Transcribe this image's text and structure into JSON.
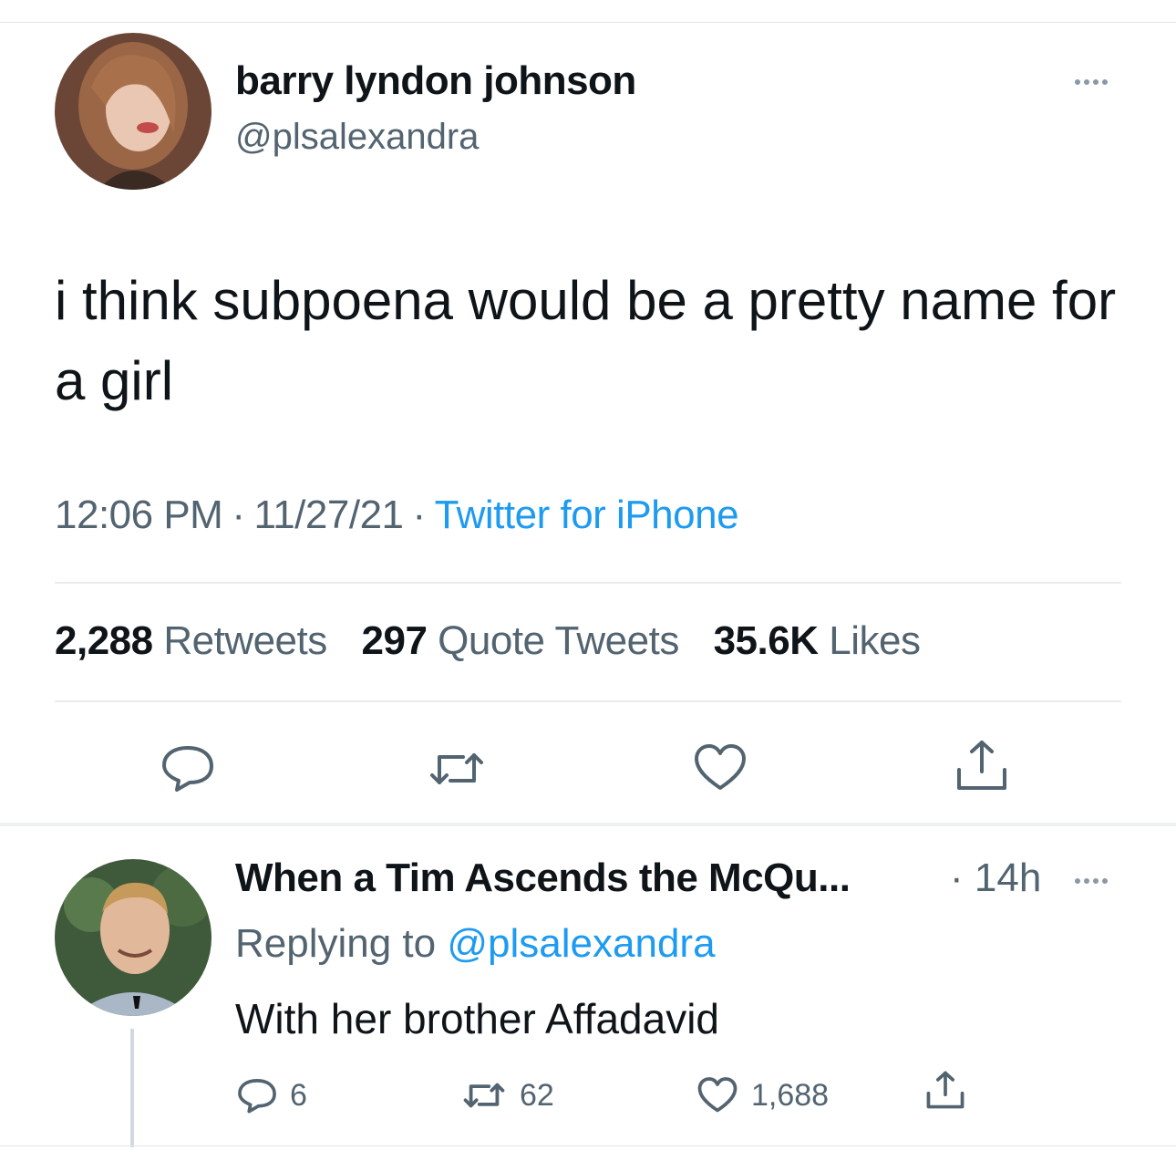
{
  "tweet": {
    "display_name": "barry lyndon johnson",
    "handle": "@plsalexandra",
    "text": "i think subpoena would be a pretty name for a girl",
    "time": "12:06 PM",
    "date": "11/27/21",
    "separator": "·",
    "source": "Twitter for iPhone",
    "stats": {
      "retweets_count": "2,288",
      "retweets_label": "Retweets",
      "quotes_count": "297",
      "quotes_label": "Quote Tweets",
      "likes_count": "35.6K",
      "likes_label": "Likes"
    },
    "icons": [
      "reply-icon",
      "retweet-icon",
      "like-icon",
      "share-icon",
      "more-icon"
    ]
  },
  "reply": {
    "display_name": "When a Tim Ascends the McQu...",
    "time": "· 14h",
    "replying_prefix": "Replying to",
    "replying_to": "@plsalexandra",
    "text": "With her brother Affadavid",
    "reply_count": "6",
    "retweet_count": "62",
    "like_count": "1,688"
  },
  "colors": {
    "accent": "#1d9bf0",
    "text": "#0f1419",
    "secondary": "#536471",
    "divider": "#e9ecef"
  }
}
